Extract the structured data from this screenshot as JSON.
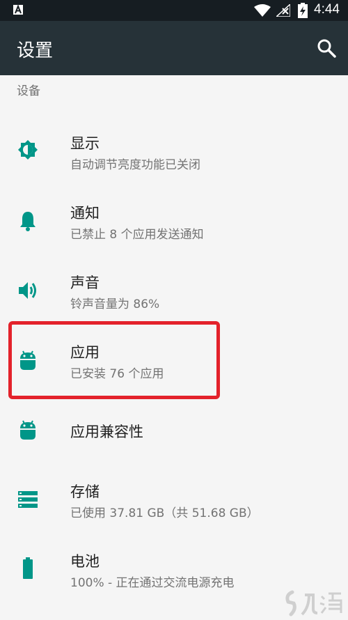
{
  "status_bar": {
    "time": "4:44",
    "icons": [
      "notification-a-icon",
      "wifi-icon",
      "no-signal-icon",
      "battery-charging-icon"
    ]
  },
  "toolbar": {
    "title": "设置",
    "search_icon": "search-icon"
  },
  "section": {
    "header": "设备"
  },
  "items": [
    {
      "icon": "brightness-icon",
      "label": "显示",
      "summary": "自动调节亮度功能已关闭"
    },
    {
      "icon": "bell-icon",
      "label": "通知",
      "summary": "已禁止 8 个应用发送通知"
    },
    {
      "icon": "volume-icon",
      "label": "声音",
      "summary": "铃声音量为 86%"
    },
    {
      "icon": "android-icon",
      "label": "应用",
      "summary": "已安装 76 个应用"
    },
    {
      "icon": "android-icon",
      "label": "应用兼容性",
      "summary": ""
    },
    {
      "icon": "storage-icon",
      "label": "存储",
      "summary": "已使用 37.81 GB（共 51.68 GB）"
    },
    {
      "icon": "battery-icon",
      "label": "电池",
      "summary": "100% - 正在通过交流电源充电"
    }
  ],
  "colors": {
    "accent": "#009688",
    "toolbar": "#263238",
    "statusbar": "#161d22",
    "highlight": "#e3222b"
  }
}
